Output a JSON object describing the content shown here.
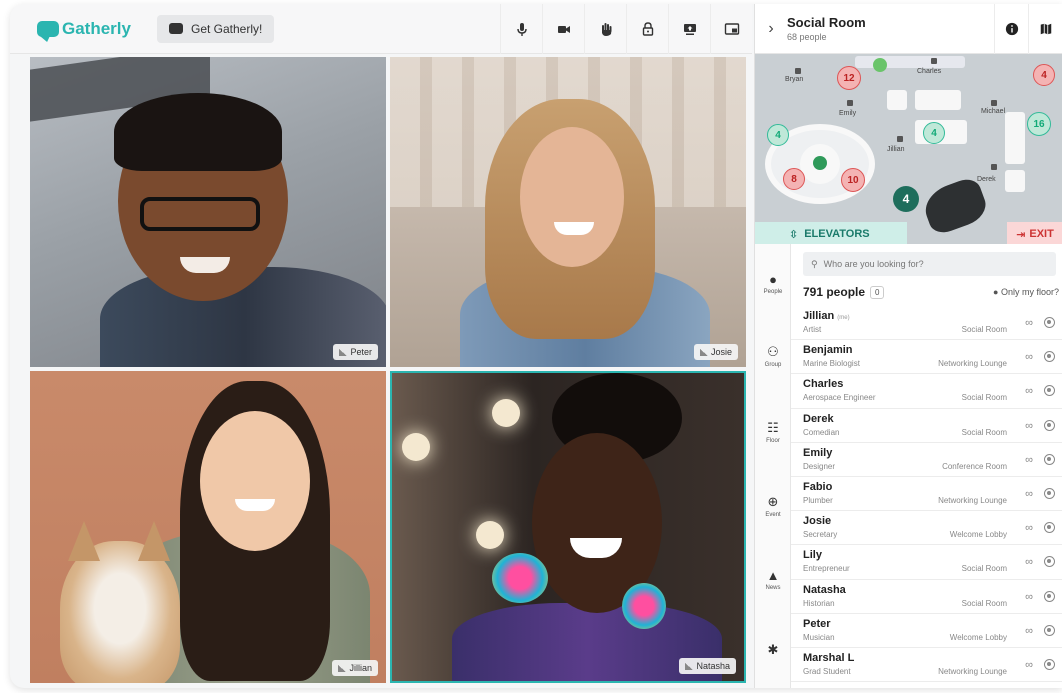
{
  "colors": {
    "brand": "#2bb5b0",
    "active_speaker": "#2bb5b0",
    "exit": "#c33333"
  },
  "topbar": {
    "logo_text": "Gatherly",
    "get_button_label": "Get Gatherly!",
    "icons": [
      "microphone-icon",
      "camera-icon",
      "raise-hand-icon",
      "lock-icon",
      "screen-share-icon",
      "picture-in-picture-icon"
    ]
  },
  "videos": [
    {
      "name": "Peter",
      "active": false
    },
    {
      "name": "Josie",
      "active": false
    },
    {
      "name": "Jillian",
      "active": false
    },
    {
      "name": "Natasha",
      "active": true
    }
  ],
  "panel": {
    "room_title": "Social Room",
    "room_subtitle": "68 people",
    "map": {
      "labels": [
        "Bryan",
        "Charles",
        "Emily",
        "Michael",
        "Jillian",
        "Derek"
      ],
      "bubbles": [
        "12",
        "4",
        "4",
        "4",
        "16",
        "8",
        "10",
        "4"
      ],
      "elevators_label": "ELEVATORS",
      "exit_label": "EXIT"
    },
    "nav": [
      {
        "label": "People"
      },
      {
        "label": "Group"
      },
      {
        "label": "Floor"
      },
      {
        "label": "Event"
      },
      {
        "label": "News"
      }
    ],
    "search_placeholder": "Who are you looking for?",
    "people_count": "791 people",
    "people_badge": "0",
    "only_my_floor": "Only my floor?",
    "people": [
      {
        "name": "Jillian",
        "me": "(me)",
        "role": "Artist",
        "location": "Social Room"
      },
      {
        "name": "Benjamin",
        "me": "",
        "role": "Marine Biologist",
        "location": "Networking Lounge"
      },
      {
        "name": "Charles",
        "me": "",
        "role": "Aerospace Engineer",
        "location": "Social Room"
      },
      {
        "name": "Derek",
        "me": "",
        "role": "Comedian",
        "location": "Social Room"
      },
      {
        "name": "Emily",
        "me": "",
        "role": "Designer",
        "location": "Conference Room"
      },
      {
        "name": "Fabio",
        "me": "",
        "role": "Plumber",
        "location": "Networking Lounge"
      },
      {
        "name": "Josie",
        "me": "",
        "role": "Secretary",
        "location": "Welcome Lobby"
      },
      {
        "name": "Lily",
        "me": "",
        "role": "Entrepreneur",
        "location": "Social Room"
      },
      {
        "name": "Natasha",
        "me": "",
        "role": "Historian",
        "location": "Social Room"
      },
      {
        "name": "Peter",
        "me": "",
        "role": "Musician",
        "location": "Welcome Lobby"
      },
      {
        "name": "Marshal L",
        "me": "",
        "role": "Grad Student",
        "location": "Networking Lounge"
      }
    ]
  }
}
